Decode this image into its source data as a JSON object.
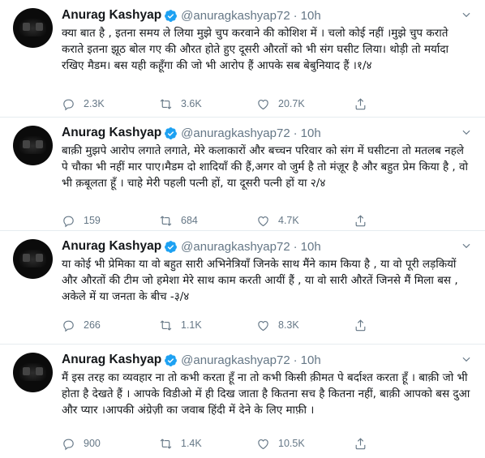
{
  "tweets": [
    {
      "author": {
        "name": "Anurag Kashyap",
        "handle": "@anuragkashyap72",
        "separator": "·",
        "time": "10h"
      },
      "text": "क्या बात है , इतना समय ले लिया मुझे चुप करवाने की कोशिश में । चलो कोई नहीं ।मुझे चुप कराते कराते इतना झूठ बोल गए की औरत होते हुए दूसरी औरतों को भी संग घसीट लिया। थोड़ी तो मर्यादा रखिए मैडम। बस यही कहूँगा की जो भी आरोप हैं आपके सब बेबुनियाद हैं ।१/४",
      "stats": {
        "replies": "2.3K",
        "retweets": "3.6K",
        "likes": "20.7K"
      }
    },
    {
      "author": {
        "name": "Anurag Kashyap",
        "handle": "@anuragkashyap72",
        "separator": "·",
        "time": "10h"
      },
      "text": "बाक़ी मुझपे आरोप लगाते लगाते, मेरे कलाकारों और बच्चन परिवार को संग में घसीटना तो मतलब नहले पे चौका भी नहीं मार पाए।मैडम दो शादियाँ की हैं,अगर वो जुर्म है तो मंज़ूर है और बहुत प्रेम किया है , वो भी क़बूलता हूँ । चाहे मेरी पहली पत्नी हों, या दूसरी पत्नी हों या २/४",
      "stats": {
        "replies": "159",
        "retweets": "684",
        "likes": "4.7K"
      }
    },
    {
      "author": {
        "name": "Anurag Kashyap",
        "handle": "@anuragkashyap72",
        "separator": "·",
        "time": "10h"
      },
      "text": "या कोई भी प्रेमिका या वो बहुत सारी अभिनेत्रियाँ जिनके साथ मैंने काम किया है , या वो पूरी लड़कियों और औरतों की टीम जो हमेशा मेरे साथ काम करती आयीं हैं , या वो सारी औरतें जिनसे मैं मिला बस , अकेले में या जनता के बीच -३/४",
      "stats": {
        "replies": "266",
        "retweets": "1.1K",
        "likes": "8.3K"
      }
    },
    {
      "author": {
        "name": "Anurag Kashyap",
        "handle": "@anuragkashyap72",
        "separator": "·",
        "time": "10h"
      },
      "text": "मैं इस तरह का व्यवहार ना तो कभी करता हूँ ना तो कभी किसी क़ीमत पे बर्दाश्त करता हूँ । बाक़ी जो भी होता है देखते हैं । आपके विडीओ में ही दिख जाता है कितना सच है कितना नहीं, बाक़ी आपको बस दुआ और प्यार ।आपकी अंग्रेज़ी का जवाब हिंदी में देने के लिए माफ़ी ।",
      "stats": {
        "replies": "900",
        "retweets": "1.4K",
        "likes": "10.5K"
      }
    }
  ],
  "icons": {
    "reply": "reply-icon",
    "retweet": "retweet-icon",
    "like": "heart-icon",
    "share": "share-icon",
    "verified": "verified-badge-icon",
    "caret": "chevron-down-icon"
  },
  "colors": {
    "verified": "#1da1f2",
    "muted": "#657786",
    "text": "#14171a",
    "divider": "#e6ecf0"
  }
}
